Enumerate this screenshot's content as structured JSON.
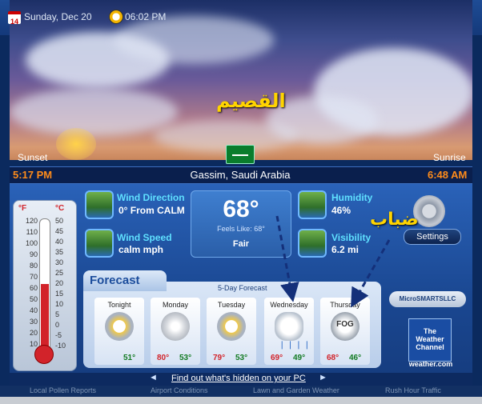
{
  "header": {
    "date": "Sunday, Dec 20",
    "time": "06:02 PM",
    "calendar_day": "14"
  },
  "scene": {
    "city_arabic": "القصيم",
    "sunset_label": "Sunset",
    "sunrise_label": "Sunrise",
    "sunset_time": "5:17 PM",
    "sunrise_time": "6:48 AM",
    "location": "Gassim, Saudi Arabia"
  },
  "thermometer": {
    "f_label": "°F",
    "c_label": "°C",
    "f_ticks": [
      "120",
      "110",
      "100",
      "90",
      "80",
      "70",
      "60",
      "50",
      "40",
      "30",
      "20",
      "10"
    ],
    "c_ticks": [
      "50",
      "45",
      "40",
      "35",
      "30",
      "25",
      "20",
      "15",
      "10",
      "5",
      "0",
      "-5",
      "-10"
    ],
    "current_f": 68
  },
  "conditions": {
    "wind_direction_title": "Wind Direction",
    "wind_direction_value": "0° From CALM",
    "wind_speed_title": "Wind Speed",
    "wind_speed_value": "calm mph",
    "temperature": "68°",
    "feels_like": "Feels Like: 68°",
    "condition": "Fair",
    "humidity_title": "Humidity",
    "humidity_value": "46%",
    "visibility_title": "Visibility",
    "visibility_value": "6.2 mi"
  },
  "settings": {
    "label": "Settings",
    "annotation_arabic": "ضباب"
  },
  "forecast": {
    "tab_label": "Forecast",
    "subtitle": "5-Day Forecast",
    "days": [
      {
        "name": "Tonight",
        "hi": "",
        "lo": "51°",
        "icon": "partly-cloudy-icon"
      },
      {
        "name": "Monday",
        "hi": "80°",
        "lo": "53°",
        "icon": "sunny-icon"
      },
      {
        "name": "Tuesday",
        "hi": "79°",
        "lo": "53°",
        "icon": "partly-cloudy-icon"
      },
      {
        "name": "Wednesday",
        "hi": "69°",
        "lo": "49°",
        "icon": "rain-icon"
      },
      {
        "name": "Thursday",
        "hi": "68°",
        "lo": "46°",
        "icon": "fog-icon",
        "icon_text": "FOG"
      }
    ]
  },
  "logos": {
    "microsmarts": "MicroSMARTSLLC",
    "twc_line1": "The",
    "twc_line2": "Weather",
    "twc_line3": "Channel",
    "twc_url": "weather.com"
  },
  "link": {
    "text": "Find out what's hidden on your PC",
    "left_arrow": "◄",
    "right_arrow": "►"
  },
  "tabs": [
    "Local Pollen Reports",
    "Airport Conditions",
    "Lawn and Garden Weather",
    "Rush Hour Traffic"
  ],
  "colors": {
    "accent_orange": "#ff8c1a",
    "stat_title_cyan": "#5fe0ff",
    "annotation_yellow": "#ffd400"
  }
}
